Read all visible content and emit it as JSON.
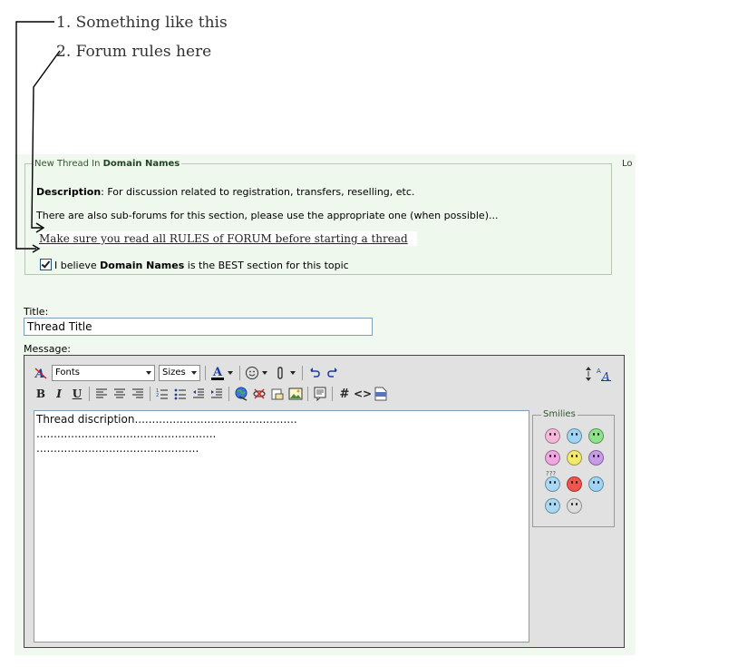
{
  "annotations": {
    "note1": "1. Something like this",
    "note2": "2. Forum rules here"
  },
  "thread_box": {
    "legend_prefix": "New Thread In",
    "forum_name": "Domain Names",
    "corner_text": "Lo",
    "description_label": "Description",
    "description_text": ": For discussion related to registration, transfers, reselling, etc.",
    "subforums_text": "There are also sub-forums for this section, please use the appropriate one (when possible)...",
    "rules_link": "Make sure you read all RULES of FORUM before starting a thread",
    "checkbox_prefix": "I believe",
    "checkbox_forum": "Domain Names",
    "checkbox_suffix": "is the BEST section for this topic",
    "checkbox_checked": true
  },
  "form": {
    "title_label": "Title:",
    "title_value": "Thread Title",
    "message_label": "Message:"
  },
  "editor": {
    "font_select": "Fonts",
    "size_select": "Sizes",
    "bold": "B",
    "italic": "I",
    "underline": "U",
    "hash": "#",
    "code": "<>",
    "message_text": "Thread discription...............................................\n....................................................\n..............................................."
  },
  "smilies": {
    "legend": "Smilies",
    "items": [
      {
        "name": "tongue-smiley",
        "color": "#f7b7d8"
      },
      {
        "name": "smile-smiley",
        "color": "#9fd4f5"
      },
      {
        "name": "grin-smiley",
        "color": "#8ee28a"
      },
      {
        "name": "wink-smiley",
        "color": "#f0a6e0"
      },
      {
        "name": "happy-smiley",
        "color": "#f3e96b"
      },
      {
        "name": "mad-smiley",
        "color": "#c89be8"
      },
      {
        "name": "confused-smiley",
        "color": "#a8d8f3"
      },
      {
        "name": "angry-smiley",
        "color": "#f0554d"
      },
      {
        "name": "rolleyes-smiley",
        "color": "#9fd4f5"
      },
      {
        "name": "cool-smiley",
        "color": "#a8d8f3"
      },
      {
        "name": "eek-smiley",
        "color": "#dddddd"
      }
    ],
    "confused_text": "???"
  },
  "colors": {
    "panel_bg": "#f1f8ef",
    "editor_bg": "#e1e1e1",
    "accent": "#2a6e2a"
  }
}
